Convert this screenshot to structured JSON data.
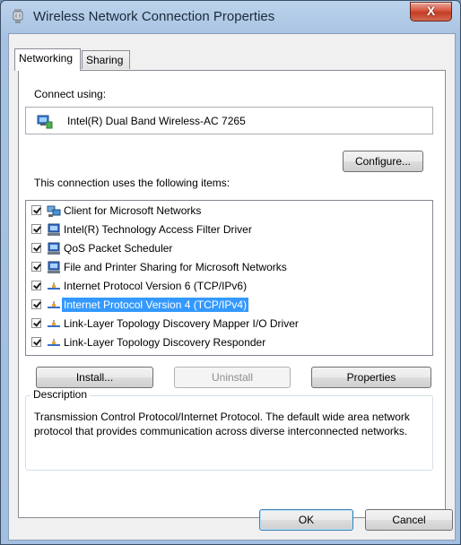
{
  "window": {
    "title": "Wireless Network Connection Properties",
    "close_label": "X"
  },
  "tabs": [
    {
      "label": "Networking",
      "active": true
    },
    {
      "label": "Sharing",
      "active": false
    }
  ],
  "connect_using": {
    "label": "Connect using:",
    "adapter": "Intel(R) Dual Band Wireless-AC 7265"
  },
  "buttons": {
    "configure": "Configure...",
    "install": "Install...",
    "uninstall": "Uninstall",
    "properties": "Properties",
    "ok": "OK",
    "cancel": "Cancel"
  },
  "items_label": "This connection uses the following items:",
  "items": [
    {
      "label": "Client for Microsoft Networks",
      "checked": true,
      "icon": "network-client-icon",
      "selected": false
    },
    {
      "label": "Intel(R) Technology Access Filter Driver",
      "checked": true,
      "icon": "network-service-icon",
      "selected": false
    },
    {
      "label": "QoS Packet Scheduler",
      "checked": true,
      "icon": "network-service-icon",
      "selected": false
    },
    {
      "label": "File and Printer Sharing for Microsoft Networks",
      "checked": true,
      "icon": "network-service-icon",
      "selected": false
    },
    {
      "label": "Internet Protocol Version 6 (TCP/IPv6)",
      "checked": true,
      "icon": "protocol-icon",
      "selected": false
    },
    {
      "label": "Internet Protocol Version 4 (TCP/IPv4)",
      "checked": true,
      "icon": "protocol-icon",
      "selected": true
    },
    {
      "label": "Link-Layer Topology Discovery Mapper I/O Driver",
      "checked": true,
      "icon": "protocol-icon",
      "selected": false
    },
    {
      "label": "Link-Layer Topology Discovery Responder",
      "checked": true,
      "icon": "protocol-icon",
      "selected": false
    }
  ],
  "description": {
    "title": "Description",
    "text": "Transmission Control Protocol/Internet Protocol. The default wide area network protocol that provides communication across diverse interconnected networks."
  },
  "colors": {
    "selection": "#3399ff",
    "close_button": "#c23d24"
  }
}
